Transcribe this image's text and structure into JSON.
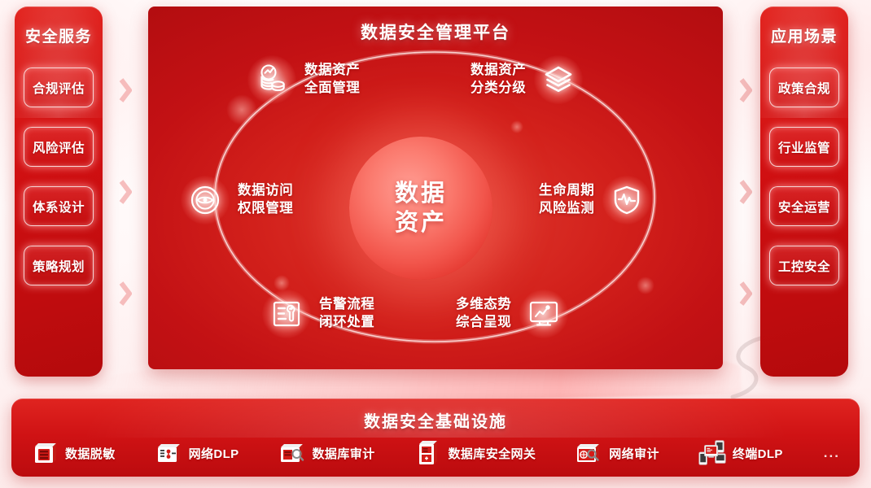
{
  "colors": {
    "brand_red": "#d2201b",
    "deep_red": "#b30d10",
    "panel_red": "#e03c30",
    "core_pink": "#fb7b6f",
    "white": "#ffffff",
    "page_bg": "#ffffff",
    "soft_pink": "#ffd7d7"
  },
  "left_panel": {
    "title": "安全服务",
    "items": [
      {
        "label": "合规评估"
      },
      {
        "label": "风险评估"
      },
      {
        "label": "体系设计"
      },
      {
        "label": "策略规划"
      }
    ]
  },
  "right_panel": {
    "title": "应用场景",
    "items": [
      {
        "label": "政策合规"
      },
      {
        "label": "行业监管"
      },
      {
        "label": "安全运营"
      },
      {
        "label": "工控安全"
      }
    ]
  },
  "center": {
    "title": "数据安全管理平台",
    "core_label": "数据\n资产",
    "nodes": [
      {
        "id": "asset-management",
        "label": "数据资产\n全面管理",
        "icon": "coins-stack-icon",
        "position": "top-left"
      },
      {
        "id": "asset-classify",
        "label": "数据资产\n分类分级",
        "icon": "layers-icon",
        "position": "top-right"
      },
      {
        "id": "access-control",
        "label": "数据访问\n权限管理",
        "icon": "eye-circle-icon",
        "position": "mid-left"
      },
      {
        "id": "lifecycle-risk",
        "label": "生命周期\n风险监测",
        "icon": "shield-pulse-icon",
        "position": "mid-right"
      },
      {
        "id": "alert-workflow",
        "label": "告警流程\n闭环处置",
        "icon": "doc-wrench-icon",
        "position": "bottom-left"
      },
      {
        "id": "situation-display",
        "label": "多维态势\n综合呈现",
        "icon": "monitor-chart-icon",
        "position": "bottom-right"
      }
    ]
  },
  "bottom_panel": {
    "title": "数据安全基础设施",
    "more": "...",
    "items": [
      {
        "label": "数据脱敏",
        "icon": "server-mask-icon"
      },
      {
        "label": "网络DLP",
        "icon": "network-dlp-icon"
      },
      {
        "label": "数据库审计",
        "icon": "db-audit-icon"
      },
      {
        "label": "数据库安全网关",
        "icon": "db-gateway-icon"
      },
      {
        "label": "网络审计",
        "icon": "net-audit-icon"
      },
      {
        "label": "终端DLP",
        "icon": "endpoint-dlp-icon"
      }
    ]
  },
  "decor": {
    "chevron_count": 3
  }
}
